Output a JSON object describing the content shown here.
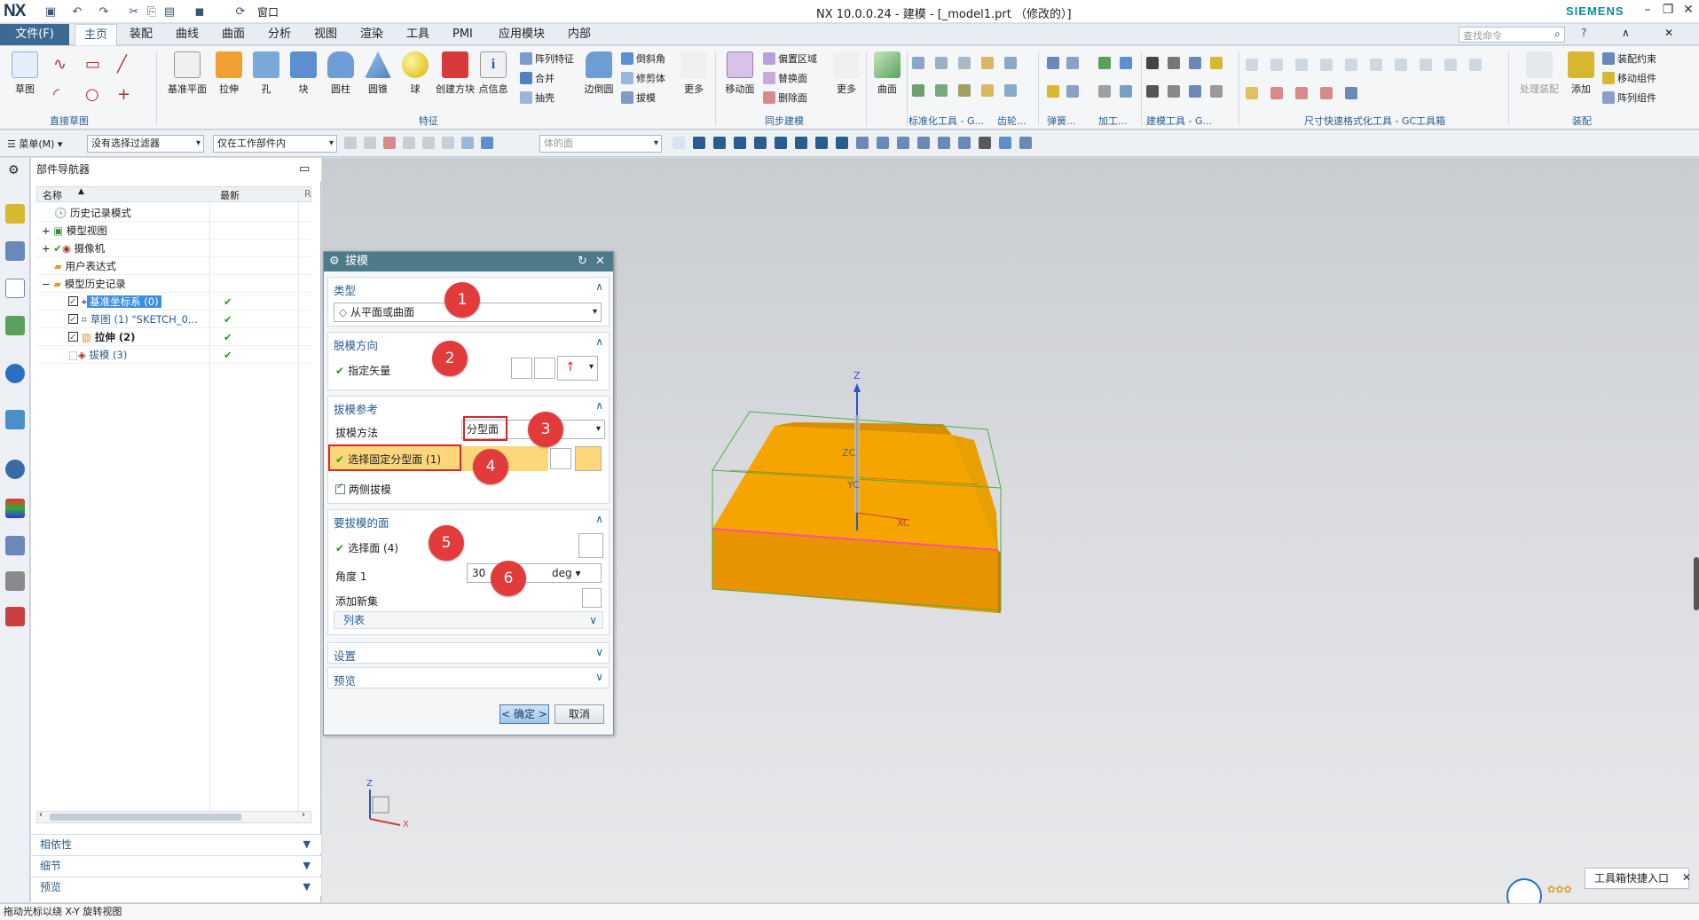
{
  "app": {
    "logo": "NX",
    "window_title": "NX 10.0.0.24 - 建模 - [_model1.prt （修改的）]",
    "brand": "SIEMENS",
    "window_menu_label": "窗口",
    "accent_color": "#3c6a93"
  },
  "menubar": {
    "file_label": "文件(F)",
    "tabs": [
      "主页",
      "装配",
      "曲线",
      "曲面",
      "分析",
      "视图",
      "渲染",
      "工具",
      "PMI",
      "应用模块",
      "内部"
    ],
    "search_placeholder": "查找命令"
  },
  "ribbon": {
    "sketch_label": "草图",
    "direct_sketch_group": "直接草图",
    "feature_buttons": [
      "基准平面",
      "拉伸",
      "孔",
      "块",
      "圆柱",
      "圆锥",
      "球",
      "创建方块",
      "点信息"
    ],
    "feature_small": [
      "阵列特征",
      "合并",
      "抽壳",
      "边倒圆",
      "倒斜角",
      "修剪体",
      "拔模"
    ],
    "more_label": "更多",
    "feature_group": "特征",
    "sync_buttons": [
      "移动面"
    ],
    "sync_small": [
      "偏置区域",
      "替换面",
      "删除面"
    ],
    "sync_group": "同步建模",
    "surface_label": "曲面",
    "more2_label": "更多",
    "std_group": "标准化工具 - G...",
    "gear_group": "齿轮...",
    "spring_group": "弹簧...",
    "process_group": "加工...",
    "model_tool_group": "建模工具 - G...",
    "dim_group": "尺寸快速格式化工具 - GC工具箱",
    "assembly_group": "装配",
    "assembly_small": [
      "装配约束",
      "移动组件",
      "阵列组件"
    ],
    "add_label": "添加",
    "process_assy_label": "处理装配"
  },
  "toolbar2": {
    "menu_label": "菜单(M)",
    "filter_value": "没有选择过滤器",
    "scope_value": "仅在工作部件内",
    "body_face_value": "体的面"
  },
  "navigator": {
    "title": "部件导航器",
    "col_name": "名称",
    "col_latest": "最新",
    "col_extra": "R",
    "items": [
      {
        "label": "历史记录模式"
      },
      {
        "label": "模型视图"
      },
      {
        "label": "摄像机"
      },
      {
        "label": "用户表达式"
      },
      {
        "label": "模型历史记录"
      },
      {
        "label": "基准坐标系 (0)"
      },
      {
        "label": "草图 (1) \"SKETCH_0..."
      },
      {
        "label": "拉伸 (2)"
      },
      {
        "label": "拔模 (3)"
      }
    ],
    "panels": [
      "相依性",
      "细节",
      "预览"
    ]
  },
  "dialog": {
    "title": "拔模",
    "type_header": "类型",
    "type_value": "从平面或曲面",
    "direction_header": "脱模方向",
    "specify_vector": "指定矢量",
    "ref_header": "拔模参考",
    "method_label": "拔模方法",
    "method_value": "分型面",
    "select_parting": "选择固定分型面 (1)",
    "both_sides": "两侧拔模",
    "faces_header": "要拔模的面",
    "select_face": "选择面 (4)",
    "angle_label": "角度 1",
    "angle_value": "30",
    "angle_unit": "deg",
    "add_set": "添加新集",
    "list_label": "列表",
    "settings_header": "设置",
    "preview_header": "预览",
    "ok_label": "< 确定 >",
    "cancel_label": "取消",
    "badges": [
      "1",
      "2",
      "3",
      "4",
      "5",
      "6"
    ]
  },
  "viewport": {
    "axis_z": "Z",
    "axis_zc": "ZC",
    "axis_yc": "YC",
    "axis_xc": "XC",
    "triad_z": "Z",
    "triad_x": "X",
    "model_color": "#f5a400"
  },
  "status": {
    "hint": "拖动光标以绕 X-Y 旋转视图",
    "toolbox_entry": "工具箱快捷入口"
  }
}
